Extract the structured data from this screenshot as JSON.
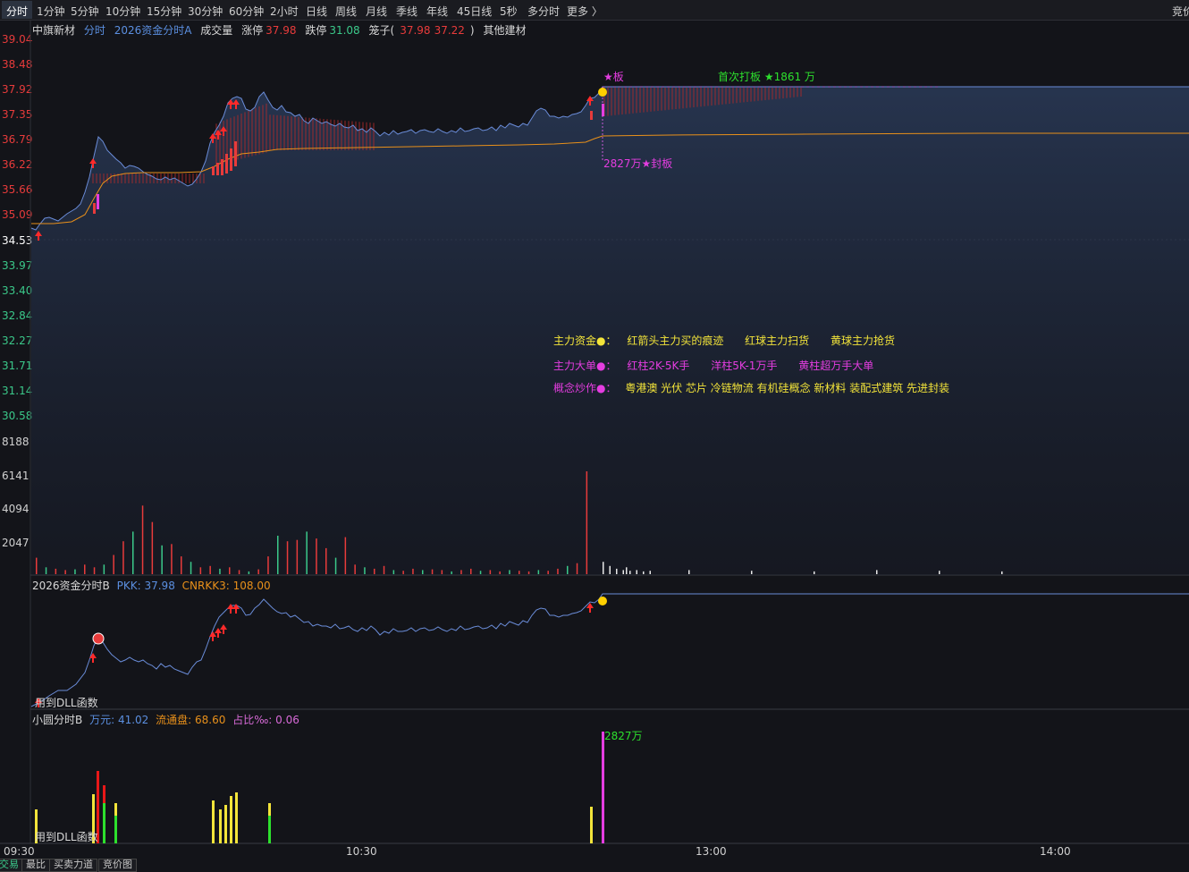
{
  "toolbar": {
    "periods": [
      "分时",
      "1分钟",
      "5分钟",
      "10分钟",
      "15分钟",
      "30分钟",
      "60分钟",
      "2小时",
      "日线",
      "周线",
      "月线",
      "季线",
      "年线",
      "45日线",
      "5秒",
      "多分时",
      "更多 〉"
    ],
    "right_label": "竞价"
  },
  "header": {
    "stock_name": "中旗新材",
    "mode": "分时",
    "indicator": "2026资金分时A",
    "volume_label": "成交量",
    "limit_up_label": "涨停",
    "limit_up_value": "37.98",
    "limit_down_label": "跌停",
    "limit_down_value": "31.08",
    "cage_label": "笼子(",
    "cage_high": "37.98",
    "cage_low": "37.22",
    "cage_close": ")",
    "sector": "其他建材"
  },
  "price_axis": {
    "ticks": [
      "39.04",
      "38.48",
      "37.92",
      "37.35",
      "36.79",
      "36.22",
      "35.66",
      "35.09",
      "34.53",
      "33.97",
      "33.40",
      "32.84",
      "32.27",
      "31.71",
      "31.14",
      "30.58"
    ],
    "ref_price": "34.53",
    "colors": {
      "up": "#e83b3b",
      "down": "#3bc98a",
      "ref": "#ffffff"
    }
  },
  "volume_axis": {
    "ticks": [
      "8188",
      "6141",
      "4094",
      "2047"
    ]
  },
  "annotations": {
    "board_tag": "★板",
    "first_board": "首次打板 ★1861 万",
    "seal": "2827万★封板"
  },
  "legend": {
    "main_fund": {
      "label": "主力资金●：",
      "a": "红箭头主力买的痕迹",
      "b": "红球主力扫货",
      "c": "黄球主力抢货"
    },
    "main_order": {
      "label": "主力大单●：",
      "a": "红柱2K-5K手",
      "b": "洋柱5K-1万手",
      "c": "黄柱超万手大单"
    },
    "concept": {
      "label": "概念炒作●：",
      "text": "粤港澳 光伏 芯片 冷链物流 有机硅概念 新材料 装配式建筑 先进封装"
    }
  },
  "panel_b": {
    "name": "2026资金分时B",
    "pkk_label": "PKK:",
    "pkk_value": "37.98",
    "cnrkk_label": "CNRKK3:",
    "cnrkk_value": "108.00",
    "dll_note": "用到DLL函数"
  },
  "panel_c": {
    "name": "小圆分时B",
    "wan_label": "万元:",
    "wan_value": "41.02",
    "float_label": "流通盘:",
    "float_value": "68.60",
    "ratio_label": "占比‰:",
    "ratio_value": "0.06",
    "peak_label": "2827万",
    "dll_note": "用到DLL函数"
  },
  "time_axis": [
    "09:30",
    "10:30",
    "13:00",
    "14:00"
  ],
  "bottom_tabs": [
    "交易",
    "最比",
    "买卖力道",
    "竞价图"
  ],
  "chart_data": [
    {
      "type": "line",
      "title": "",
      "xlabel": "",
      "ylabel": "",
      "x": [
        "09:30",
        "09:35",
        "09:40",
        "09:45",
        "09:50",
        "09:55",
        "10:00",
        "10:05",
        "10:10",
        "10:15",
        "10:20",
        "10:25",
        "10:30",
        "10:35",
        "10:40",
        "10:45",
        "10:50",
        "10:55",
        "11:00",
        "11:05",
        "11:10",
        "11:15",
        "11:20",
        "11:25",
        "11:30"
      ],
      "series": [
        {
          "name": "",
          "values": [
            34.53,
            34.95,
            35.1,
            36.2,
            36.85,
            36.2,
            36.1,
            35.95,
            36.0,
            37.6,
            37.7,
            37.3,
            37.45,
            37.2,
            37.0,
            37.0,
            37.1,
            36.95,
            37.05,
            37.0,
            37.1,
            37.25,
            37.4,
            37.55,
            37.98
          ]
        },
        {
          "name": "",
          "values": [
            34.9,
            34.92,
            35.1,
            35.7,
            35.95,
            36.0,
            36.0,
            36.0,
            36.0,
            36.4,
            36.55,
            36.6,
            36.63,
            36.65,
            36.67,
            36.68,
            36.7,
            36.72,
            36.73,
            36.75,
            36.76,
            36.78,
            36.8,
            36.82,
            36.9
          ]
        }
      ],
      "ylim": [
        30.02,
        39.04
      ]
    },
    {
      "type": "bar",
      "title": "",
      "ylim": [
        0,
        10235
      ],
      "values": [
        1200,
        500,
        400,
        300,
        350,
        700,
        500,
        700,
        1400,
        2400,
        3100,
        5000,
        3800,
        2100,
        2200,
        1300,
        900,
        500,
        600,
        400,
        500,
        300,
        200,
        350,
        1300,
        2800,
        2400,
        2500,
        3100,
        2600,
        1900,
        1200,
        2700,
        700,
        500,
        400,
        600,
        300,
        250,
        400,
        300,
        350,
        300,
        200,
        300,
        400,
        250,
        300,
        200,
        300,
        250,
        200,
        300,
        250,
        400,
        600,
        800,
        7500,
        900,
        600,
        400,
        300,
        250,
        300,
        200,
        250,
        500,
        300,
        250,
        200,
        300,
        250,
        200
      ]
    }
  ]
}
